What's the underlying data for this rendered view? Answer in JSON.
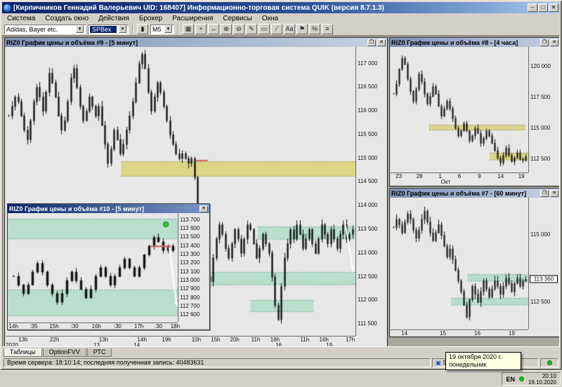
{
  "window": {
    "title": "[Кирпичников Геннадий Валерьевич UID: 168407] Информационно-торговая система QUIK (версия 8.7.1.3)"
  },
  "icons": {
    "dropdown": "▾",
    "minimize": "–",
    "maximize": "□",
    "restore": "❐",
    "close": "✕",
    "computer": "▣",
    "candle": "▮"
  },
  "menu": {
    "items": [
      "Система",
      "Создать окно",
      "Действия",
      "Брокер",
      "Расширения",
      "Сервисы",
      "Окна"
    ]
  },
  "toolbar": {
    "symbol_combo": "Adidas, Bayer etc.",
    "class_combo": "SPBex",
    "timeframe": "M5",
    "icons": [
      {
        "name": "chart-grid-icon",
        "glyph": "▦"
      },
      {
        "name": "crosshair-icon",
        "glyph": "+"
      },
      {
        "name": "pan-icon",
        "glyph": "↔"
      },
      {
        "name": "zoom-in-icon",
        "glyph": "⊕"
      },
      {
        "name": "zoom-out-icon",
        "glyph": "⊖"
      },
      {
        "name": "pencil-icon",
        "glyph": "✎"
      },
      {
        "name": "eraser-icon",
        "glyph": "▭"
      },
      {
        "name": "trendline-icon",
        "glyph": "∕"
      },
      {
        "name": "text-tool-icon",
        "glyph": "Aa"
      },
      {
        "name": "flag-icon",
        "glyph": "⚑"
      },
      {
        "name": "percent-icon",
        "glyph": "%"
      },
      {
        "name": "levels-icon",
        "glyph": "≡"
      }
    ]
  },
  "tabs": {
    "items": [
      "Таблицы",
      "OptionFVV",
      "РТС"
    ]
  },
  "statusbar": {
    "server_text": "Время сервера: 18:10:14; последняя полученная запись: 40483631",
    "connection": "91.207.78.204:15100"
  },
  "tray": {
    "lang": "EN",
    "time": "20:10",
    "date": "19.10.2020",
    "tooltip_line1": "19 октября 2020 г.",
    "tooltip_line2": "понедельник"
  },
  "colors": {
    "khaki": "#d9d37b",
    "khaki_edge": "#97923a",
    "green": "#b2ddc8",
    "green_edge": "#63b192",
    "title_accent": "#0a246a",
    "candle": "#151515"
  },
  "chart_data": {
    "c9": {
      "type": "candlestick",
      "title": "RIZ0 График цены и объёма #9 - [5 минут]",
      "ymin": 111250,
      "ymax": 117350,
      "wick": 90,
      "closes": [
        115900,
        116100,
        116300,
        116200,
        115900,
        115600,
        115400,
        115800,
        116200,
        116500,
        116300,
        116000,
        116400,
        116800,
        116600,
        116300,
        115900,
        115600,
        115800,
        116200,
        116700,
        116900,
        116500,
        116100,
        115800,
        116000,
        116300,
        116100,
        115900,
        116100,
        115700,
        115300,
        114900,
        115200,
        115600,
        115400,
        115100,
        115300,
        115600,
        115900,
        116200,
        116600,
        117000,
        117200,
        116900,
        116400,
        116000,
        116300,
        116600,
        116400,
        116100,
        115800,
        115500,
        115300,
        115100,
        115000,
        115100,
        115000,
        114900,
        115000,
        114600,
        113900,
        113300,
        112800,
        112500,
        112400,
        112900,
        113300,
        113600,
        113400,
        113100,
        112900,
        113200,
        113500,
        113300,
        113000,
        113300,
        113600,
        113500,
        113200,
        112900,
        113100,
        113400,
        113200,
        113000,
        112500,
        111900,
        111600,
        112300,
        112900,
        113200,
        113500,
        113300,
        113600,
        113400,
        113100,
        113300,
        113500,
        113200,
        113000,
        113300,
        113600,
        113400,
        113200,
        113500,
        113300,
        113100,
        113400,
        113600,
        113300,
        113400,
        113500
      ],
      "ylabels": [
        {
          "p": 117000,
          "t": "117 000"
        },
        {
          "p": 116500,
          "t": "116 500"
        },
        {
          "p": 116000,
          "t": "116 000"
        },
        {
          "p": 115500,
          "t": "115 500"
        },
        {
          "p": 115000,
          "t": "115 000"
        },
        {
          "p": 114500,
          "t": "114 500"
        },
        {
          "p": 114000,
          "t": "114 000"
        },
        {
          "p": 113500,
          "t": "113 500"
        },
        {
          "p": 113000,
          "t": "113 000"
        },
        {
          "p": 112500,
          "t": "112 500"
        },
        {
          "p": 112000,
          "t": "112 000"
        },
        {
          "p": 111500,
          "t": "111 500"
        }
      ],
      "xticks": [
        {
          "pos": 0.05,
          "t": "13h"
        },
        {
          "pos": 0.14,
          "t": "22h"
        },
        {
          "pos": 0.28,
          "t": "13h"
        },
        {
          "pos": 0.39,
          "t": "14h"
        },
        {
          "pos": 0.46,
          "t": "19h"
        },
        {
          "pos": 0.545,
          "t": "10h"
        },
        {
          "pos": 0.6,
          "t": "15h"
        },
        {
          "pos": 0.655,
          "t": "20h"
        },
        {
          "pos": 0.715,
          "t": "11h"
        },
        {
          "pos": 0.77,
          "t": "16h"
        },
        {
          "pos": 0.855,
          "t": "11h"
        },
        {
          "pos": 0.91,
          "t": "16h"
        },
        {
          "pos": 0.985,
          "t": "17h"
        }
      ],
      "xdates": [
        {
          "pos": 0.018,
          "t": "2020"
        },
        {
          "pos": 0.26,
          "t": "13"
        },
        {
          "pos": 0.375,
          "t": "14"
        },
        {
          "pos": 0.78,
          "t": "16"
        },
        {
          "pos": 0.925,
          "t": "19"
        }
      ],
      "bands": [
        {
          "x1": 0.33,
          "x2": 1.0,
          "p1": 114620,
          "p2": 114930,
          "color": "khaki"
        },
        {
          "x1": 0.72,
          "x2": 1.0,
          "p1": 113290,
          "p2": 113550,
          "color": "green"
        },
        {
          "x1": 0.57,
          "x2": 1.0,
          "p1": 112330,
          "p2": 112590,
          "color": "green"
        },
        {
          "x1": 0.7,
          "x2": 0.88,
          "p1": 111760,
          "p2": 112000,
          "color": "green"
        }
      ],
      "markers": [
        {
          "type": "hseg",
          "x1": 0.545,
          "x2": 0.578,
          "p": 114950,
          "color": "#e06060"
        },
        {
          "type": "arrow",
          "x1": 0.972,
          "x2": 0.993,
          "p1": 113580,
          "p2": 112620,
          "color": "#ffffff"
        }
      ]
    },
    "c8": {
      "type": "candlestick",
      "title": "RIZ0 График цены и объёма #8 - [4 часа]",
      "ymin": 111400,
      "ymax": 121600,
      "wick": 250,
      "closes": [
        117800,
        118600,
        119800,
        120700,
        120200,
        119000,
        118000,
        117200,
        118200,
        119400,
        118800,
        117800,
        117000,
        117600,
        118400,
        117800,
        116800,
        116000,
        116600,
        117200,
        116600,
        115800,
        115000,
        114400,
        114800,
        115400,
        114800,
        114000,
        114400,
        115000,
        114600,
        113800,
        114200,
        114800,
        114400,
        113800,
        113200,
        112600,
        112200,
        112800,
        113400,
        112800,
        112300,
        112600,
        113000,
        112500,
        112400,
        112700
      ],
      "ylabels": [
        {
          "p": 120000,
          "t": "120 000"
        },
        {
          "p": 117500,
          "t": "117 500"
        },
        {
          "p": 115000,
          "t": "115 000"
        },
        {
          "p": 112500,
          "t": "112 500"
        }
      ],
      "xticks": [
        {
          "pos": 0.06,
          "t": "23"
        },
        {
          "pos": 0.21,
          "t": "28"
        },
        {
          "pos": 0.36,
          "t": "1"
        },
        {
          "pos": 0.5,
          "t": "6"
        },
        {
          "pos": 0.645,
          "t": "9"
        },
        {
          "pos": 0.8,
          "t": "14"
        },
        {
          "pos": 0.95,
          "t": "19"
        }
      ],
      "xdates": [
        {
          "pos": 0.4,
          "t": "Окт"
        }
      ],
      "bands": [
        {
          "x1": 0.28,
          "x2": 0.98,
          "p1": 114850,
          "p2": 115250,
          "color": "khaki"
        },
        {
          "x1": 0.72,
          "x2": 1.0,
          "p1": 112420,
          "p2": 112980,
          "color": "khaki"
        }
      ],
      "markers": []
    },
    "c7": {
      "type": "candlestick",
      "title": "RIZ0 График цены и объёма #7 - [60 минут]",
      "ymin": 111500,
      "ymax": 116400,
      "wick": 150,
      "closes": [
        115300,
        115600,
        115400,
        115100,
        115500,
        115800,
        115600,
        115200,
        114900,
        115200,
        115600,
        115900,
        115500,
        115100,
        114800,
        115100,
        115400,
        115000,
        114600,
        114200,
        114500,
        114100,
        113700,
        113300,
        112900,
        112400,
        111950,
        112600,
        113100,
        112800,
        112500,
        112900,
        113300,
        113000,
        112700,
        113000,
        113300,
        113100,
        112800,
        113100,
        113400,
        113200,
        112900,
        113200,
        113400,
        113100,
        113300,
        113360
      ],
      "ylabels": [
        {
          "p": 115000,
          "t": "115 000"
        },
        {
          "p": 112500,
          "t": "112 500"
        }
      ],
      "xticks": [
        {
          "pos": 0.1,
          "t": "14"
        },
        {
          "pos": 0.38,
          "t": "15"
        },
        {
          "pos": 0.63,
          "t": "16"
        },
        {
          "pos": 0.88,
          "t": "19"
        }
      ],
      "bands": [
        {
          "x1": 0.56,
          "x2": 1.0,
          "p1": 113280,
          "p2": 113530,
          "color": "green"
        },
        {
          "x1": 0.44,
          "x2": 1.0,
          "p1": 112390,
          "p2": 112640,
          "color": "green"
        }
      ],
      "markers": [
        {
          "type": "pricetag",
          "p": 113360,
          "t": "113 360"
        }
      ]
    },
    "c10": {
      "type": "candlestick",
      "title": "RIZ0 График цены и объёма #10 - [5 минут]",
      "ymin": 112520,
      "ymax": 113780,
      "wick": 35,
      "closes": [
        113050,
        112950,
        112850,
        112950,
        113100,
        113200,
        113100,
        112950,
        112850,
        112750,
        112850,
        113000,
        113100,
        113000,
        112900,
        112800,
        112900,
        113050,
        113150,
        113050,
        112950,
        113050,
        113150,
        113250,
        113150,
        113050,
        113150,
        113300,
        113400,
        113500,
        113450,
        113350,
        113400,
        113350
      ],
      "ylabels": [
        {
          "p": 113700,
          "t": "113 700"
        },
        {
          "p": 113600,
          "t": "113 600"
        },
        {
          "p": 113500,
          "t": "113 500"
        },
        {
          "p": 113400,
          "t": "113 400"
        },
        {
          "p": 113300,
          "t": "113 300"
        },
        {
          "p": 113200,
          "t": "113 200"
        },
        {
          "p": 113100,
          "t": "113 100"
        },
        {
          "p": 113000,
          "t": "113 000"
        },
        {
          "p": 112900,
          "t": "112 900"
        },
        {
          "p": 112800,
          "t": "112 800"
        },
        {
          "p": 112700,
          "t": "112 700"
        },
        {
          "p": 112600,
          "t": "112 600"
        }
      ],
      "xticks": [
        {
          "pos": 0.03,
          "t": "14h"
        },
        {
          "pos": 0.15,
          "t": ":35"
        },
        {
          "pos": 0.27,
          "t": "15h"
        },
        {
          "pos": 0.39,
          "t": ":30"
        },
        {
          "pos": 0.52,
          "t": "16h"
        },
        {
          "pos": 0.645,
          "t": ":30"
        },
        {
          "pos": 0.77,
          "t": "17h"
        },
        {
          "pos": 0.885,
          "t": ":30"
        },
        {
          "pos": 0.985,
          "t": "18h"
        }
      ],
      "bands": [
        {
          "x1": 0.0,
          "x2": 1.0,
          "p1": 113480,
          "p2": 113710,
          "color": "green"
        },
        {
          "x1": 0.0,
          "x2": 1.0,
          "p1": 112590,
          "p2": 112890,
          "color": "green"
        }
      ],
      "markers": [
        {
          "type": "dot",
          "x": 0.93,
          "p": 113650,
          "color": "#2ecc2e"
        },
        {
          "type": "hseg",
          "x1": 0.84,
          "x2": 0.96,
          "p": 113395,
          "color": "#e06060"
        },
        {
          "type": "arrow",
          "x1": 0.95,
          "x2": 0.995,
          "p1": 113380,
          "p2": 112700,
          "color": "#ffffff"
        }
      ]
    }
  }
}
